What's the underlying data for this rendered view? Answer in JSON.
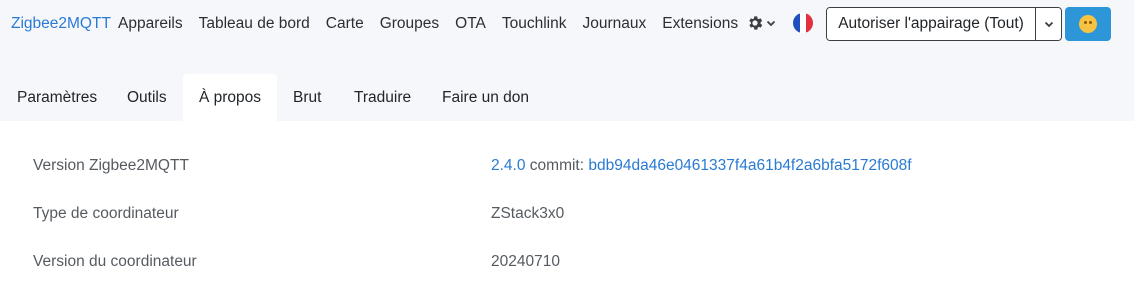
{
  "navbar": {
    "brand": "Zigbee2MQTT",
    "links": [
      "Appareils",
      "Tableau de bord",
      "Carte",
      "Groupes",
      "OTA",
      "Touchlink",
      "Journaux",
      "Extensions"
    ],
    "settings_icon": "gear-icon",
    "language_icon": "flag-fr-icon",
    "permit_join_label": "Autoriser l'appairage (Tout)",
    "permit_caret_icon": "chevron-down-icon",
    "avatar_icon": "avatar-icon"
  },
  "tabs": [
    {
      "label": "Paramètres",
      "active": false
    },
    {
      "label": "Outils",
      "active": false
    },
    {
      "label": "À propos",
      "active": true
    },
    {
      "label": "Brut",
      "active": false
    },
    {
      "label": "Traduire",
      "active": false
    },
    {
      "label": "Faire un don",
      "active": false
    }
  ],
  "about": {
    "rows": [
      {
        "label": "Version Zigbee2MQTT",
        "version": "2.4.0",
        "commit_prefix": "commit:",
        "commit": "bdb94da46e0461337f4a61b4f2a6bfa5172f608f"
      },
      {
        "label": "Type de coordinateur",
        "value": "ZStack3x0"
      },
      {
        "label": "Version du coordinateur",
        "value": "20240710"
      }
    ]
  },
  "colors": {
    "accent": "#2a7ad5",
    "avatar_button": "#2d96d8",
    "background": "#f6f7fb"
  }
}
